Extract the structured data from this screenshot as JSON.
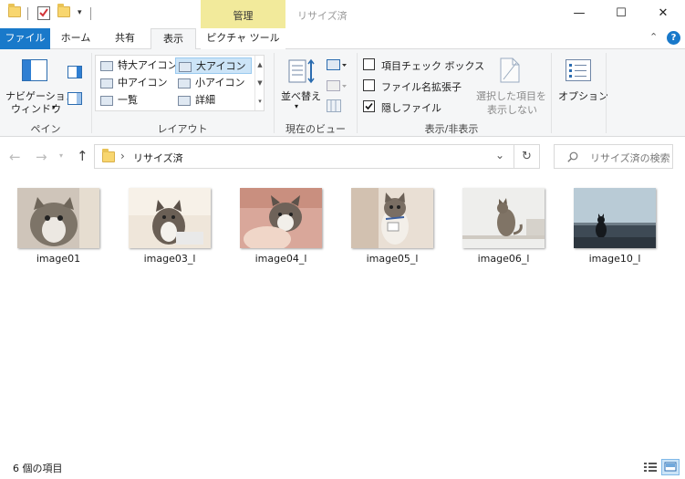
{
  "titlebar": {
    "context_tab": "管理",
    "window_title": "リサイズ済",
    "minimize": "—",
    "maximize": "☐",
    "close": "✕"
  },
  "tabs": {
    "file": "ファイル",
    "home": "ホーム",
    "share": "共有",
    "view": "表示",
    "picture_tools": "ピクチャ ツール"
  },
  "ribbon": {
    "pane": {
      "nav_pane_line1": "ナビゲーション",
      "nav_pane_line2": "ウィンドウ",
      "group_label": "ペイン"
    },
    "layout": {
      "items": [
        "特大アイコン",
        "大アイコン",
        "中アイコン",
        "小アイコン",
        "一覧",
        "詳細"
      ],
      "selected": "大アイコン",
      "group_label": "レイアウト"
    },
    "current_view": {
      "sort_by": "並べ替え",
      "group_label": "現在のビュー"
    },
    "show_hide": {
      "item_checkboxes": "項目チェック ボックス",
      "file_extensions": "ファイル名拡張子",
      "hidden_items": "隠しファイル",
      "hide_selected_line1": "選択した項目を",
      "hide_selected_line2": "表示しない",
      "group_label": "表示/非表示",
      "item_checkboxes_checked": false,
      "file_extensions_checked": false,
      "hidden_items_checked": true
    },
    "options": {
      "label": "オプション"
    }
  },
  "address": {
    "separator": "›",
    "folder": "リサイズ済",
    "dropdown": "⌄",
    "refresh": "↻"
  },
  "search": {
    "placeholder": "リサイズ済の検索"
  },
  "files": [
    {
      "name": "image01"
    },
    {
      "name": "image03_l"
    },
    {
      "name": "image04_l"
    },
    {
      "name": "image05_l"
    },
    {
      "name": "image06_l"
    },
    {
      "name": "image10_l"
    }
  ],
  "status": {
    "item_count": "6 個の項目"
  },
  "colors": {
    "accent": "#1979ca",
    "context_tab": "#f2ea9b",
    "ribbon_bg": "#f5f6f7",
    "selection": "#cce4f7",
    "folder": "#f8d66f"
  }
}
